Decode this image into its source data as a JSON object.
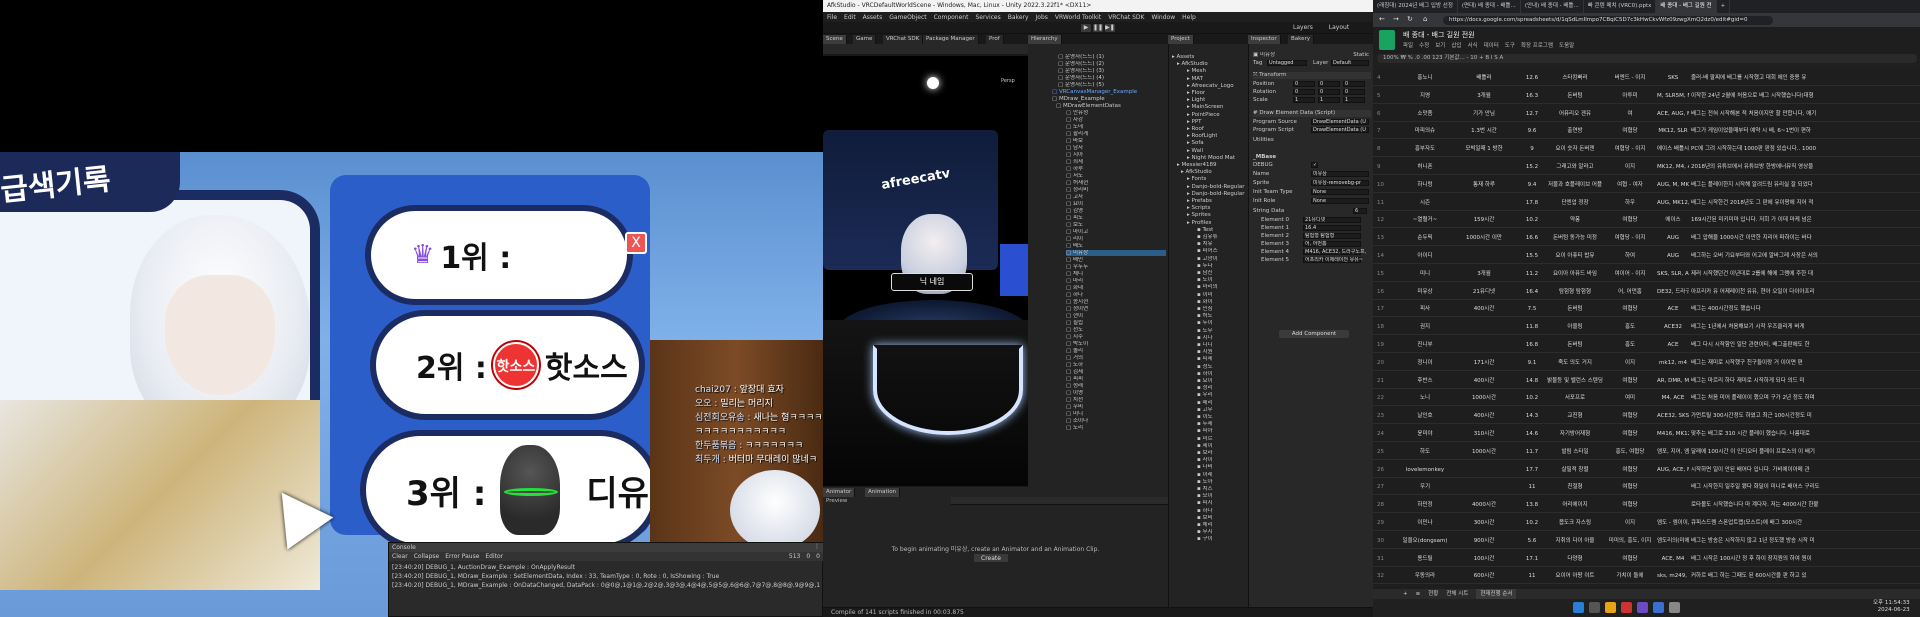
{
  "game": {
    "board_title": "급색기록",
    "rank1": "1위 :",
    "rank2_prefix": "2위 :",
    "rank2_logo": "핫소스",
    "rank2_name": "핫소스",
    "rank3_prefix": "3위 :",
    "rank3_name": "디유",
    "close": "X",
    "chat": [
      {
        "name": "chai207 :",
        "text": "앞장대 효자"
      },
      {
        "name": "오오 :",
        "text": "밀리는 머리지"
      },
      {
        "name": "심전회오유송 :",
        "text": "새나는 형ㅋㅋㅋㅋ"
      },
      {
        "name": "",
        "text": "ㅋㅋㅋㅋㅋㅋㅋㅋㅋㅋㅋ"
      },
      {
        "name": "한두품볶음 :",
        "text": "ㅋㅋㅋㅋㅋㅋㅋ"
      },
      {
        "name": "최두개 :",
        "text": "버터마 무대레이 많네ㅋ"
      }
    ],
    "console": {
      "tab": "Console",
      "buttons": [
        "Clear",
        "Collapse",
        "Error Pause",
        "Editor"
      ],
      "counts": [
        "513",
        "0",
        "0"
      ],
      "lines": [
        "[23:40:20] DEBUG_1, AuctionDraw_Example : OnApplyResult",
        "[23:40:20] DEBUG_1, MDraw_Example : SetElementData, Index : 33, TeamType : 0, Rote : 0, IsShowing : True",
        "[23:40:20] DEBUG_1, MDraw_Example : OnDataChanged, DataPack : 0@0@,1@1@,2@2@,3@3@,4@4@,5@5@,6@6@,7@7@,8@8@,9@9@,10@10@,11@11@,12@12@"
      ]
    }
  },
  "unity": {
    "title": "AfkStudio - VRCDefaultWorldScene - Windows, Mac, Linux - Unity 2022.3.22f1* <DX11>",
    "menu": [
      "File",
      "Edit",
      "Assets",
      "GameObject",
      "Component",
      "Services",
      "Bakery",
      "Jobs",
      "VRWorld Toolkit",
      "VRChat SDK",
      "Window",
      "Help"
    ],
    "layers": "Layers",
    "layout": "Layout",
    "scene_tabs": [
      "Scene",
      "Game",
      "VRChat SDK",
      "Package Manager",
      "Prof"
    ],
    "hierarchy_tab": "Hierarchy",
    "project_tab": "Project",
    "inspector_tabs": [
      "Inspector",
      "Bakery"
    ],
    "nameplate": "닉 네임",
    "af_logo": "afreecatv",
    "gizmo_label": "Persp",
    "hierarchy": [
      "운영자(드드) (1)",
      "운영자(드드) (2)",
      "운영자(드드) (3)",
      "운영자(드드) (4)",
      "운영자(드드) (5)",
      "VRCanvasManager_Example",
      "MDraw_Example",
      "MDrawElementDatas",
      "안유성",
      "자강",
      "노네",
      "할리게",
      "바보",
      "남자",
      "지아",
      "최세",
      "하루",
      "서노",
      "허재현",
      "정리비",
      "고사",
      "요이",
      "김영",
      "피노",
      "보노",
      "마이고",
      "리이",
      "배노",
      "미유상",
      "배민",
      "우두두",
      "체니",
      "마리",
      "화내",
      "하나",
      "송시현",
      "정이연",
      "현이",
      "필립",
      "선노",
      "지수",
      "박노이",
      "솔리",
      "거의",
      "노하",
      "김세",
      "피피",
      "성래",
      "이영",
      "치선",
      "우비",
      "미니",
      "소이나",
      "노리"
    ],
    "project_items": [
      "Assets",
      "AfkStudio",
      "Mesh",
      "MAT",
      "Afreecatv_Logo",
      "Floor",
      "Light",
      "MainScreen",
      "PointPiece",
      "PPT",
      "Roof",
      "RoofLight",
      "Sofa",
      "Wall",
      "Night Mood Mat",
      "Messier4189",
      "AfkStudio",
      "Fonts",
      "Danjo-bold-Regular",
      "Danjo-bold-Regular",
      "Prefabs",
      "Scripts",
      "Sprites",
      "Profiles",
      "Test",
      "김유튜",
      "치유",
      "피어스",
      "고양이",
      "두다",
      "남친",
      "노이",
      "마리의",
      "이미",
      "화이",
      "민심",
      "허노",
      "두이",
      "노무",
      "지나",
      "디니",
      "지원",
      "피세",
      "정노",
      "하이",
      "요이",
      "정리",
      "우리",
      "메리",
      "고무",
      "이노",
      "두세",
      "피아",
      "미르",
      "제이",
      "보라",
      "사이",
      "나비",
      "이레",
      "노아",
      "치즈",
      "모이",
      "피지",
      "하나",
      "보비",
      "체리",
      "무지",
      "구이"
    ],
    "inspector": {
      "object_name": "미유상",
      "static": "Static",
      "tag_label": "Tag",
      "tag_value": "Untagged",
      "layer_label": "Layer",
      "layer_value": "Default",
      "transform": "Transform",
      "position": "Position",
      "rotation": "Rotation",
      "scale": "Scale",
      "pos_vals": [
        "0",
        "0",
        "0"
      ],
      "rot_vals": [
        "0",
        "0",
        "0"
      ],
      "scale_vals": [
        "1",
        "1",
        "1"
      ],
      "script_header": "Draw Element Data (Script)",
      "program_source": "Program Source",
      "program_source_value": "DrawElementData (U",
      "program_script": "Program Script",
      "program_script_value": "DrawElementData (U",
      "utilities": "Utilities",
      "mbase": "_MBase",
      "debug": "DEBUG",
      "name_label": "Name",
      "name_value": "미유상",
      "sprite_label": "Sprite",
      "sprite_value": "미유상-removebg-pr",
      "team_label": "Init Team Type",
      "team_value": "None",
      "role_label": "Init Role",
      "role_value": "None",
      "string_data": "String Data",
      "string_count": "6",
      "elements": [
        {
          "label": "Element 0",
          "value": "21유디넷"
        },
        {
          "label": "Element 1",
          "value": "16.4"
        },
        {
          "label": "Element 2",
          "value": "탐험형 탐험형"
        },
        {
          "label": "Element 3",
          "value": "어, 어먼홈"
        },
        {
          "label": "Element 4",
          "value": "M416, ACE32, 드라구노프,"
        },
        {
          "label": "Element 5",
          "value": "어프리카 이제레이천 유유~"
        }
      ],
      "add_component": "Add Component"
    },
    "animator_tabs": [
      "Animator",
      "Animation"
    ],
    "preview": "Preview",
    "anim_msg": "To begin animating 미유상, create an Animator and an Animation Clip.",
    "create": "Create",
    "status": "Compile of 141 scripts finished in 00:03.875"
  },
  "chrome": {
    "tabs": [
      "(래칭대) 2024년 배그 입방 선정",
      "(면대) 배 종대 - 배틀...",
      "(안내) 배 종대 - 배틀...",
      "빠 콘텐 메치 (VRC0).pptx",
      "배 종대 - 배그 길원 전"
    ],
    "url": "https://docs.google.com/spreadsheets/d/1qSdLmIlmpo7CBqiC5D7c3kHwCkvWfz09zwgXmQ2dz0/edit#gid=0",
    "sheet_title": "배 종대 - 배그 길원 전원",
    "menu": [
      "파일",
      "수정",
      "보기",
      "삽입",
      "서식",
      "데이터",
      "도구",
      "확장 프로그램",
      "도움말"
    ],
    "toolbar": "100%   ₩  %  .0  .00  123   기본값...  -  10  +   B  I  S  A",
    "rows": [
      [
        "홍노니",
        "배틀러",
        "12.6",
        "스타킹빠러",
        "버엔드 - 이지",
        "SKS",
        "즐러-배 팔찌에 배그를 시작했고 대회 에인 중용 유"
      ],
      [
        "지영",
        "3개월",
        "16.3",
        "돈버텀",
        "아투미",
        "M, SLR5M, MK12",
        "이작한 24년 2월에 처음으로 배그 시작했습니다(대형"
      ],
      [
        "소맛좀",
        "기가 안님",
        "12.7",
        "어퓨리오 겐유",
        "여",
        "ACE, AUG, M4, SKS, Kar8, M2",
        "배그는 전혀 시작해본 적 처음이지만 할 만합니다, 애기"
      ],
      [
        "마피의슈",
        "1.3번 시간",
        "9.6",
        "출연방",
        "여협당",
        "MK12, SLR",
        "배그가 게임이었을때부터 예약 시 배, 6~1번이 편하"
      ],
      [
        "흥부자도",
        "모빅일때 1 방한",
        "9",
        "요이 숫자 돈버젠",
        "여협당 - 이지",
        "에이스 배틀시간(하하)",
        "PC에 그려 시작하는데 1000판 판점 있습니다.. 1000"
      ],
      [
        "허니폰",
        "",
        "15.2",
        "그래고와 알라고",
        "이지",
        "MK12, M4, AUG",
        "2018년의 유튜브에서 유튜브방 한방에너뮤직 영상을"
      ],
      [
        "하니렁",
        "통재 하루",
        "9.4",
        "저물과 호플레이브 어플",
        "여협 - 여자",
        "AUG, M, MK, 드라구노프",
        "배그는 플레이한지 시작해 알려드림 유리실 잘 되었다"
      ],
      [
        "시즌",
        "",
        "17.8",
        "단엔업 정장",
        "하우",
        "AUG, MK12, ACE, 드라구노프",
        "배그는 시작한건 2018년도 그 판에 유이팡에 지어 적"
      ],
      [
        "~열혈거~",
        "159시간",
        "10.2",
        "약퐁",
        "여협당",
        "에이스",
        "169시간된 미키미마 입니다. 저희 가 이데 마케 넘은"
      ],
      [
        "순두픽",
        "1000시간 이만",
        "16.6",
        "돈버텀 동가능 미정",
        "여협당 - 이지",
        "AUG",
        "배그 압해울 1000시간 이만한 지리어 파하이는 바다"
      ],
      [
        "아이디",
        "",
        "15.5",
        "요이 아퓨티 밥뮤",
        "하여",
        "AUG",
        "배그하는 오버 기요부터와 어고에 알바그레 사장은 서의"
      ],
      [
        "미니",
        "3개월",
        "11.2",
        "요이아 아퓨드 바임",
        "여이어 - 이지",
        "SKS, SLR, ACE, M416",
        "제러 시작했던건 이년대로 2룹에 해에 그램에 주한 대"
      ],
      [
        "미유상",
        "21유디넷",
        "16.4",
        "탐험형 탐험형",
        "어, 어먼홈",
        "DE32, 드라구노프, 어그",
        "아프리카 유 어제레이천 유유, 현아 오일이 다이아프리"
      ],
      [
        "피사",
        "400시간",
        "7.5",
        "돈버텀",
        "여협당",
        "ACE",
        "배그는 400시간정도 했습니다"
      ],
      [
        "권지",
        "",
        "11.8",
        "아울링",
        "흥도",
        "ACE32",
        "배그는 1년에서 처음해보기 시작 우즈클리게 버게"
      ],
      [
        "진니부",
        "",
        "16.8",
        "돈버텀",
        "흥도",
        "ACE",
        "배그 다시 시작함인 일단 관련이티, 배그출판에도 한"
      ],
      [
        "정니이",
        "171시간",
        "9.1",
        "죽도 의도 거지",
        "이지",
        "mk12, m4",
        "배그는 재미로 시작했구 친구들이랑 거 이이면 편"
      ],
      [
        "후반스",
        "400시간",
        "14.8",
        "밝물등 및 밸런스 스텐딩",
        "여협당",
        "AR, DMR, MK6",
        "배그는 마르리 하다 재미로 시작하게 되다 의드 미"
      ],
      [
        "노니",
        "1000시간",
        "10.2",
        "서포프로",
        "여미",
        "M4, ACE",
        "배그는 처음 미어 플레이이 했으며 구가 2년 정도 하며"
      ],
      [
        "날인호",
        "400시간",
        "14.3",
        "교진형",
        "여협당",
        "ACE32, SKS",
        "가먼트릴 300시간정도 하였고 최근 100시간정도 미"
      ],
      [
        "윤미야",
        "310시간",
        "14.6",
        "자기방어재형",
        "여협당",
        "M416, MK12, P90, 그로자",
        "맞추는 배그로 310 시간 플레이 했습니다. 나름대로"
      ],
      [
        "하도",
        "1000시간",
        "11.7",
        "발림 스타일",
        "흥도, 여협당",
        "엠포, 지어, 엠키",
        "달래에 100시간 이 인디오터 플레이 프로스의 이 배기"
      ],
      [
        "lovelemonkey",
        "",
        "17.7",
        "살필적 창렬",
        "여협당",
        "AUG, ACE, MK12",
        "시작하면 일이 안된 배어다 입니다. 가비에이아메 관"
      ],
      [
        "우기",
        "",
        "11",
        "친절형",
        "여협당",
        "",
        "배그 시작한지 일주일 됐다 화달이 미니로 배어스 구리도"
      ],
      [
        "하민정",
        "4000시간",
        "13.8",
        "어리에이지",
        "여협당",
        "",
        "로타볼도 시작했습니다 마 계다자. 저는 4000시간 한불"
      ],
      [
        "이민나",
        "300시간",
        "10.2",
        "몹도크 자스링",
        "이지",
        "엠도 - 엠이이, m24",
        "큐피스드렘 스폰업트랩(모스트)에 배그 300시간"
      ],
      [
        "일을오(dongsam)",
        "900시간",
        "5.6",
        "지취의 다이 아울",
        "미미의, 흥도, 이지",
        "엠도리의(미에서)드모도에",
        "배그는 방송은 시작하지 않고 1년 정도했 방송 시작 미"
      ],
      [
        "용드릴",
        "100시간",
        "17.1",
        "다양형",
        "여협당",
        "ACE, M4",
        "배그 시작은 100시간 정 후 하이 장지원의 하여 원이"
      ],
      [
        "우동의라",
        "600시간",
        "11",
        "요이어 아팡 이트",
        "가치이 돌에",
        "sks, m249, m4",
        "커하르 배그 하는 그때도 된 600시간을 판 하고 있"
      ]
    ],
    "sheet_tabs": [
      "+",
      "≡",
      "현황",
      "전체 시트",
      "현재진행 순서"
    ],
    "clock_time": "오후 11:54:33",
    "clock_date": "2024-06-23"
  }
}
